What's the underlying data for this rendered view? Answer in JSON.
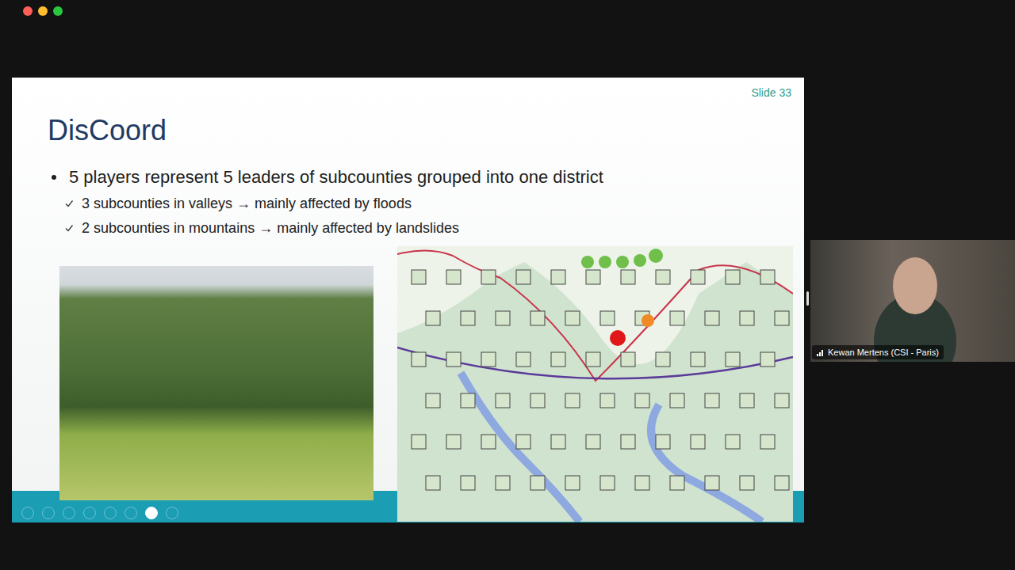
{
  "window": {
    "controls": [
      {
        "name": "close",
        "color": "#ff5f57"
      },
      {
        "name": "minimize",
        "color": "#febc2e"
      },
      {
        "name": "zoom",
        "color": "#28c840"
      }
    ]
  },
  "slide": {
    "number_label": "Slide 33",
    "title": "DisCoord",
    "bullets": [
      {
        "text": "5 players represent 5 leaders of subcounties grouped into one district",
        "sub": [
          "3 subcounties in valleys → mainly affected by floods",
          "2 subcounties in mountains → mainly affected by landslides"
        ]
      }
    ]
  },
  "participant": {
    "name": "Kewan Mertens (CSI - Paris)"
  }
}
